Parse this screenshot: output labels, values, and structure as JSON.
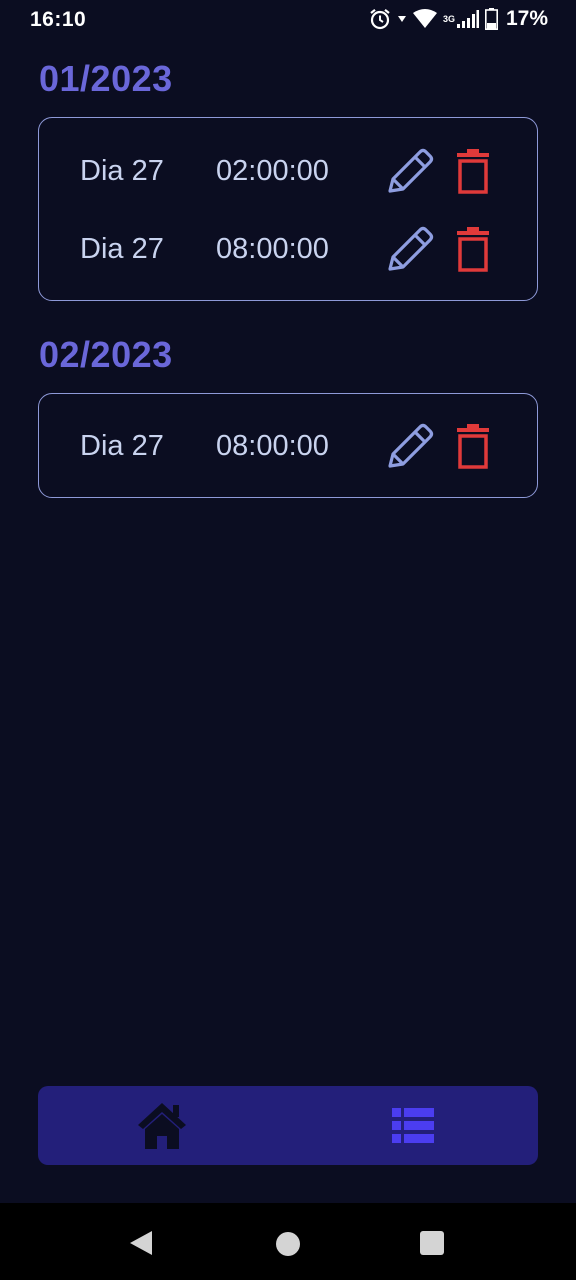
{
  "status_bar": {
    "time": "16:10",
    "network_label": "3G",
    "battery": "17%",
    "icons": [
      "alarm-icon",
      "wifi-icon",
      "signal-icon",
      "battery-icon"
    ]
  },
  "months": [
    {
      "title": "01/2023",
      "entries": [
        {
          "day": "Dia 27",
          "time": "02:00:00"
        },
        {
          "day": "Dia 27",
          "time": "08:00:00"
        }
      ]
    },
    {
      "title": "02/2023",
      "entries": [
        {
          "day": "Dia 27",
          "time": "08:00:00"
        }
      ]
    }
  ],
  "icons": {
    "edit": "pencil-icon",
    "delete": "trash-icon",
    "nav_home": "home-icon",
    "nav_list": "list-icon"
  },
  "colors": {
    "background": "#0b0d21",
    "accent": "#6a67d9",
    "card_border": "#8e99d8",
    "text": "#c9d3ef",
    "edit_icon": "#8e9de0",
    "delete_icon": "#e03a3a",
    "nav_background": "#231f7a",
    "nav_active": "#4b3df0",
    "nav_inactive": "#0b0d21"
  }
}
